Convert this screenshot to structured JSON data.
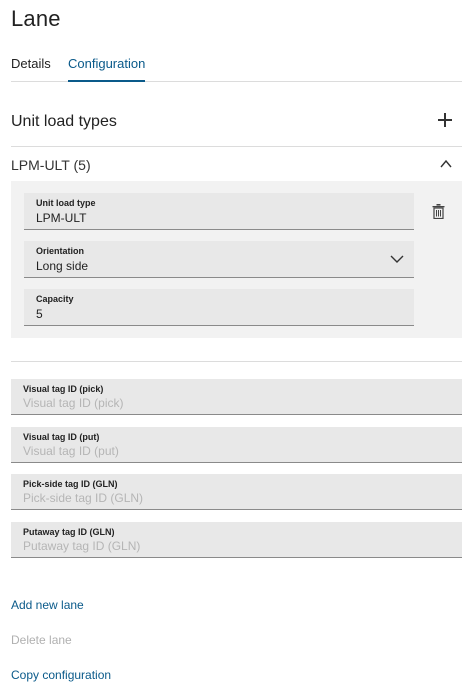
{
  "page": {
    "title": "Lane"
  },
  "tabs": [
    {
      "label": "Details",
      "active": false
    },
    {
      "label": "Configuration",
      "active": true
    }
  ],
  "unit_load_types": {
    "title": "Unit load types",
    "add_icon": "plus-icon",
    "group": {
      "header": "LPM-ULT (5)",
      "collapse_icon": "chevron-up-icon",
      "delete_icon": "trash-icon",
      "fields": {
        "unit_load_type": {
          "label": "Unit load type",
          "value": "LPM-ULT"
        },
        "orientation": {
          "label": "Orientation",
          "value": "Long side",
          "icon": "chevron-down-icon"
        },
        "capacity": {
          "label": "Capacity",
          "value": "5"
        }
      }
    }
  },
  "tag_fields": [
    {
      "label": "Visual tag ID (pick)",
      "placeholder": "Visual tag ID (pick)"
    },
    {
      "label": "Visual tag ID (put)",
      "placeholder": "Visual tag ID (put)"
    },
    {
      "label": "Pick-side tag ID (GLN)",
      "placeholder": "Pick-side tag ID (GLN)"
    },
    {
      "label": "Putaway tag ID (GLN)",
      "placeholder": "Putaway tag ID (GLN)"
    }
  ],
  "actions": {
    "add_new_lane": "Add new lane",
    "delete_lane": "Delete lane",
    "copy_configuration": "Copy configuration"
  },
  "colors": {
    "accent": "#0a5a8a",
    "field_bg": "#e8e8e8",
    "panel_bg": "#f2f2f2",
    "disabled_text": "#b0b0b0"
  }
}
